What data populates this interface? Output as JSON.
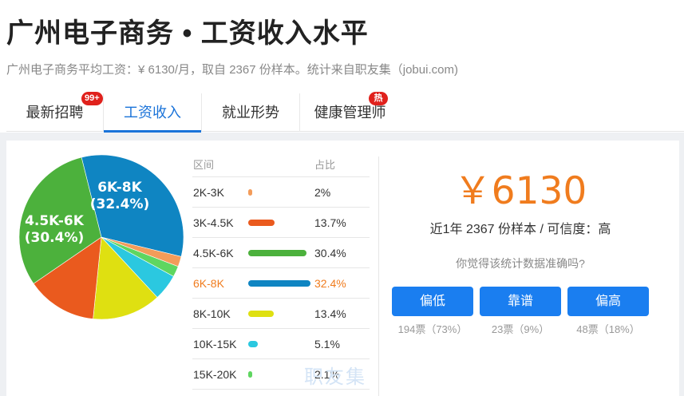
{
  "page": {
    "title": "广州电子商务 • 工资收入水平",
    "subtitle": "广州电子商务平均工资：¥ 6130/月，取自 2367 份样本。统计来自职友集（jobui.com)"
  },
  "tabs": [
    {
      "label": "最新招聘",
      "badge": "99+"
    },
    {
      "label": "工资收入",
      "badge": ""
    },
    {
      "label": "就业形势",
      "badge": ""
    },
    {
      "label": "健康管理师",
      "badge": "热"
    }
  ],
  "colors": {
    "accent": "#1a73d9",
    "highlight": "#f07c1e",
    "button": "#1a7ef0",
    "badge": "#e0211c"
  },
  "distribution": {
    "header_range": "区间",
    "header_pct": "占比",
    "rows": [
      {
        "range": "2K-3K",
        "pct": "2%",
        "value": 2,
        "color": "#f39c5a"
      },
      {
        "range": "3K-4.5K",
        "pct": "13.7%",
        "value": 13.7,
        "color": "#ea5a1e"
      },
      {
        "range": "4.5K-6K",
        "pct": "30.4%",
        "value": 30.4,
        "color": "#4cb13c"
      },
      {
        "range": "6K-8K",
        "pct": "32.4%",
        "value": 32.4,
        "color": "#0f85c2",
        "highlight": true
      },
      {
        "range": "8K-10K",
        "pct": "13.4%",
        "value": 13.4,
        "color": "#dfe011"
      },
      {
        "range": "10K-15K",
        "pct": "5.1%",
        "value": 5.1,
        "color": "#2bc8e0"
      },
      {
        "range": "15K-20K",
        "pct": "2.1%",
        "value": 2.1,
        "color": "#5fd660"
      }
    ]
  },
  "pie_labels": {
    "top_range": "6K-8K",
    "top_pct": "(32.4%)",
    "left_range": "4.5K-6K",
    "left_pct": "(30.4%)"
  },
  "summary": {
    "average": "￥6130",
    "sample": "近1年 2367 份样本 / 可信度：高",
    "question": "你觉得该统计数据准确吗?"
  },
  "votes": [
    {
      "label": "偏低",
      "count": "194票（73%）"
    },
    {
      "label": "靠谱",
      "count": "23票（9%）"
    },
    {
      "label": "偏高",
      "count": "48票（18%）"
    }
  ],
  "watermark": "职友集"
}
